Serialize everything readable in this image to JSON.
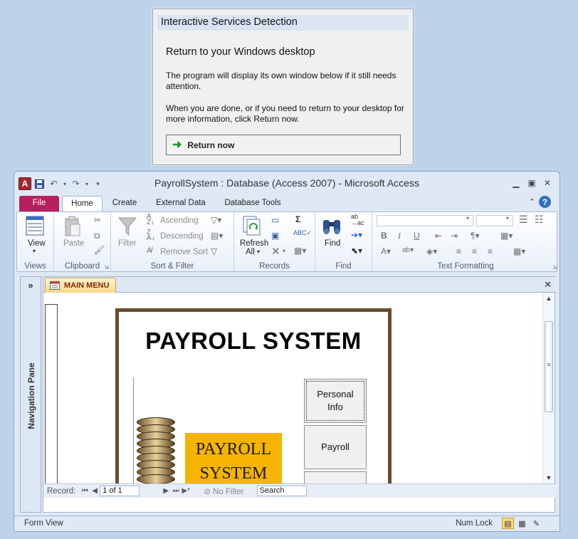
{
  "dialog": {
    "title": "Interactive Services Detection",
    "heading": "Return to your Windows desktop",
    "para1": "The program will display its own window below if it still needs attention.",
    "para2": "When you are done, or if you need to return to your desktop for more information, click Return now.",
    "return_button": "Return now"
  },
  "window": {
    "title": "PayrollSystem : Database (Access 2007)  -  Microsoft Access",
    "app_letter": "A"
  },
  "ribbon_tabs": [
    "File",
    "Home",
    "Create",
    "External Data",
    "Database Tools"
  ],
  "ribbon": {
    "views": {
      "label": "Views",
      "view": "View"
    },
    "clipboard": {
      "label": "Clipboard",
      "paste": "Paste"
    },
    "sort_filter": {
      "label": "Sort & Filter",
      "filter": "Filter",
      "ascending": "Ascending",
      "descending": "Descending",
      "remove_sort": "Remove Sort"
    },
    "records": {
      "label": "Records",
      "refresh": "Refresh",
      "all": "All"
    },
    "find": {
      "label": "Find",
      "find": "Find"
    },
    "text_formatting": {
      "label": "Text Formatting"
    }
  },
  "nav_pane": {
    "label": "Navigation Pane"
  },
  "document": {
    "tab": "MAIN MENU"
  },
  "form": {
    "title": "PAYROLL SYSTEM",
    "image_text_1": "PAYROLL",
    "image_text_2": "SYSTEM",
    "buttons": [
      "Personal Info",
      "Payroll",
      ""
    ]
  },
  "record_nav": {
    "label": "Record:",
    "position": "1 of 1",
    "no_filter": "No Filter",
    "search": "Search"
  },
  "status": {
    "left": "Form View",
    "num_lock": "Num Lock"
  },
  "colors": {
    "file_tab": "#b6205c",
    "form_border": "#6b4a2e",
    "image_bg": "#f6b300",
    "access_brand": "#a4262c"
  }
}
